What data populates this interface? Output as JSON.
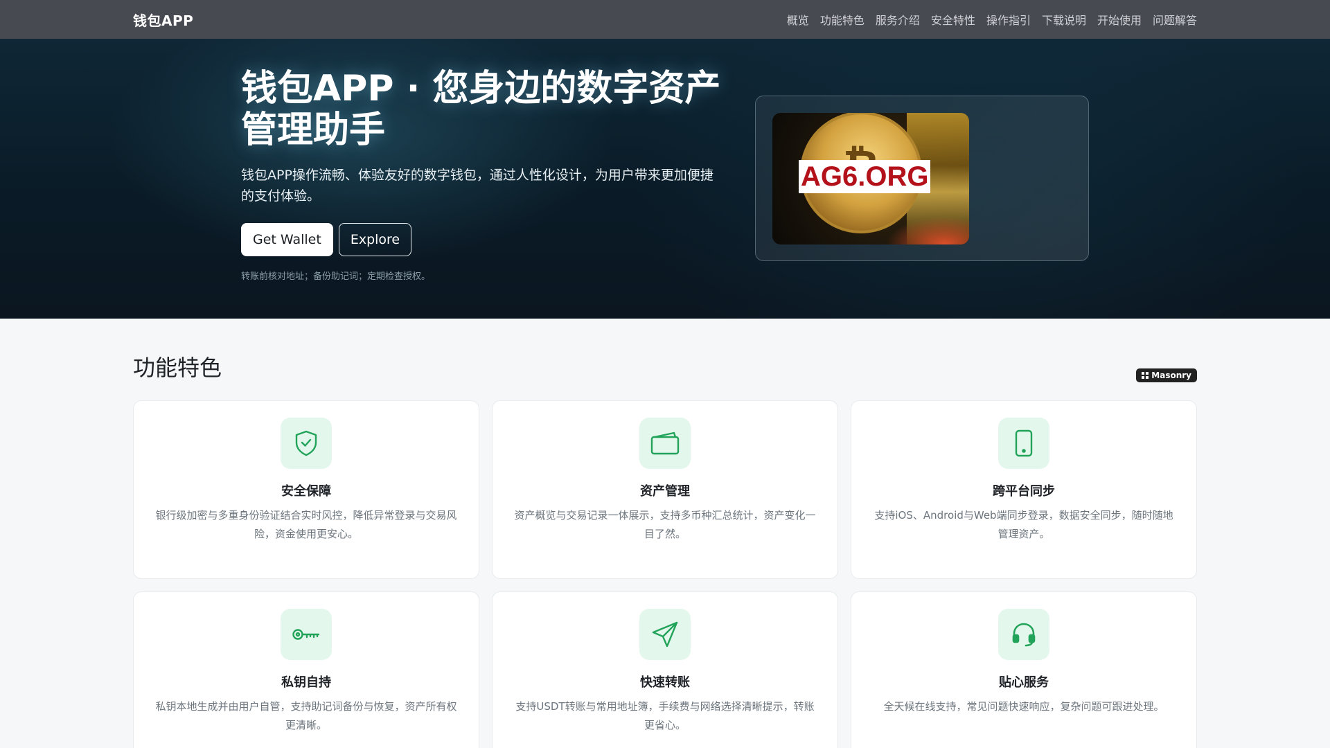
{
  "navbar": {
    "brand": "钱包APP",
    "links": [
      "概览",
      "功能特色",
      "服务介绍",
      "安全特性",
      "操作指引",
      "下载说明",
      "开始使用",
      "问题解答"
    ]
  },
  "hero": {
    "title": "钱包APP · 您身边的数字资产管理助手",
    "subtitle": "钱包APP操作流畅、体验友好的数字钱包，通过人性化设计，为用户带来更加便捷的支付体验。",
    "primary_button": "Get Wallet",
    "secondary_button": "Explore",
    "note": "转账前核对地址；备份助记词；定期检查授权。",
    "image_watermark": "AG6.ORG",
    "image_symbol": "₿"
  },
  "features": {
    "title": "功能特色",
    "badge": "Masonry",
    "items": [
      {
        "icon": "shield-check-icon",
        "title": "安全保障",
        "desc": "银行级加密与多重身份验证结合实时风控，降低异常登录与交易风险，资金使用更安心。"
      },
      {
        "icon": "wallet-icon",
        "title": "资产管理",
        "desc": "资产概览与交易记录一体展示，支持多币种汇总统计，资产变化一目了然。"
      },
      {
        "icon": "tablet-icon",
        "title": "跨平台同步",
        "desc": "支持iOS、Android与Web端同步登录，数据安全同步，随时随地管理资产。"
      },
      {
        "icon": "key-icon",
        "title": "私钥自持",
        "desc": "私钥本地生成并由用户自管，支持助记词备份与恢复，资产所有权更清晰。"
      },
      {
        "icon": "send-icon",
        "title": "快速转账",
        "desc": "支持USDT转账与常用地址簿，手续费与网络选择清晰提示，转账更省心。"
      },
      {
        "icon": "headset-icon",
        "title": "贴心服务",
        "desc": "全天候在线支持，常见问题快速响应，复杂问题可跟进处理。"
      }
    ]
  },
  "colors": {
    "accent_green": "#22a35a",
    "icon_bg": "#e4f7ec",
    "navbar_bg": "#484a52",
    "hero_bg": "#0f2736"
  }
}
